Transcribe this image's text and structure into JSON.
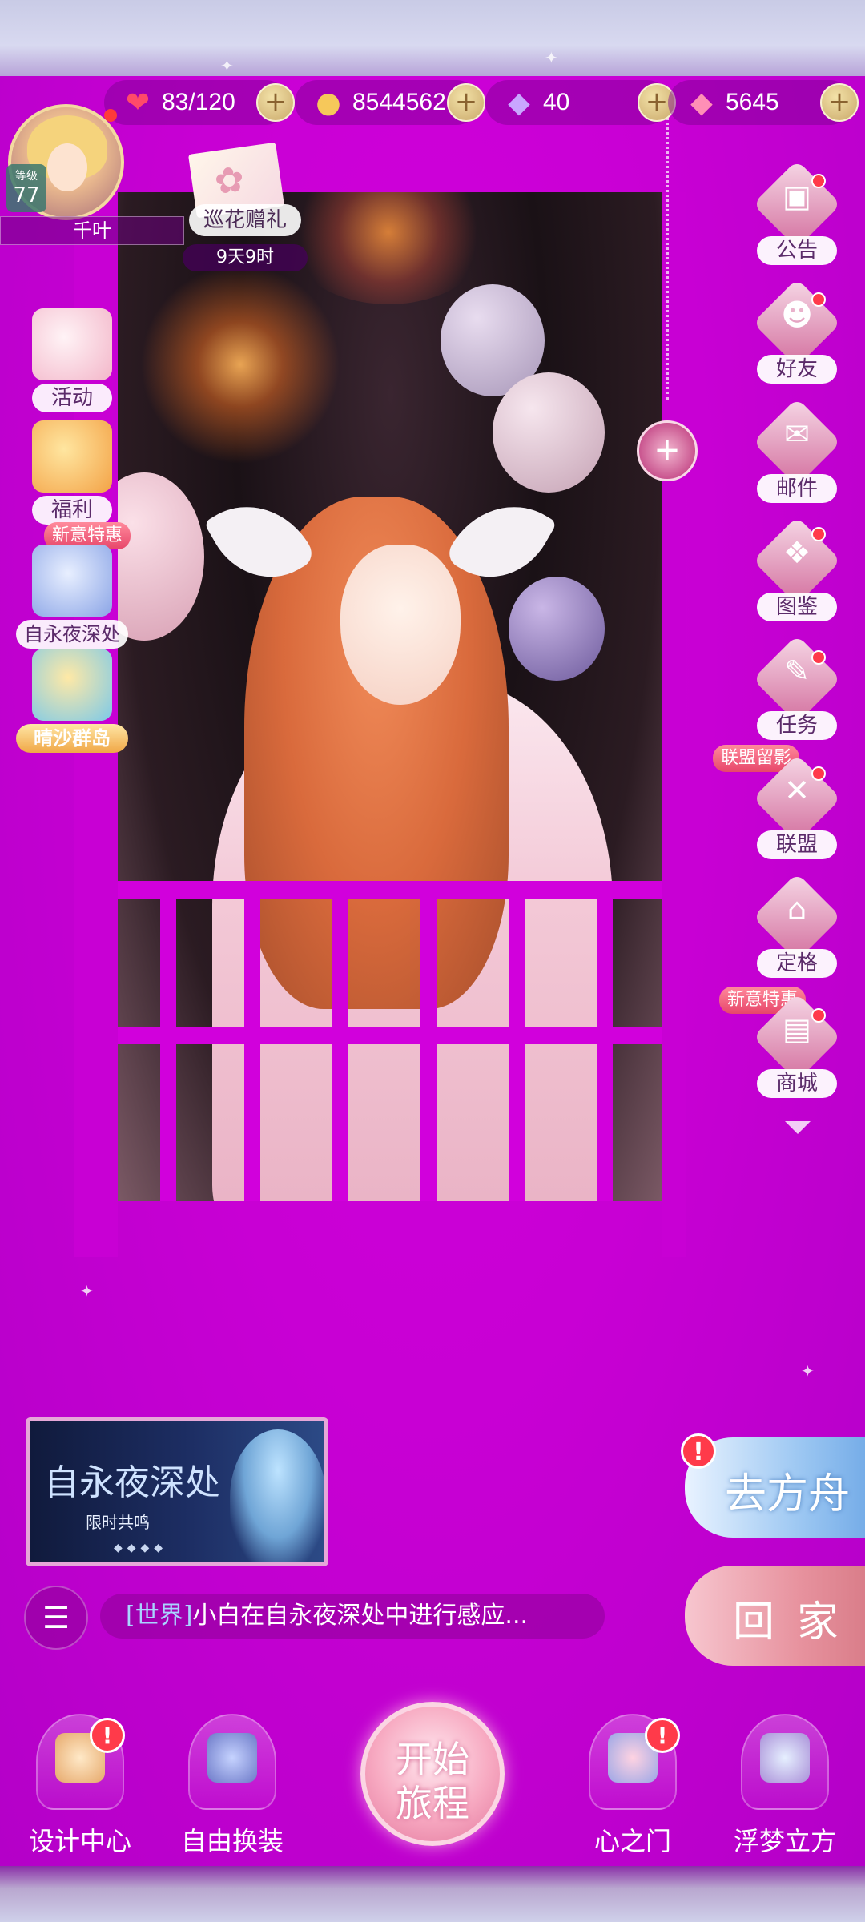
{
  "currencies": [
    {
      "icon": "heart-icon",
      "value": "83/120"
    },
    {
      "icon": "cat-coin-icon",
      "value": "8544562"
    },
    {
      "icon": "diamond-icon",
      "value": "40"
    },
    {
      "icon": "pink-diamond-icon",
      "value": "5645"
    }
  ],
  "player": {
    "level_label": "等级",
    "level": "77",
    "name": "千叶"
  },
  "event": {
    "label": "巡花赠礼",
    "timer": "9天9时"
  },
  "left_menu": {
    "activity": "活动",
    "welfare": "福利",
    "new_offer_badge": "新意特惠",
    "eternal_night": "自永夜深处",
    "sand_islands": "晴沙群岛"
  },
  "right_menu": {
    "announcement": "公告",
    "friends": "好友",
    "mail": "邮件",
    "gallery": "图鉴",
    "tasks": "任务",
    "alliance_badge": "联盟留影",
    "alliance": "联盟",
    "pose": "定格",
    "shop_badge": "新意特惠",
    "shop": "商城"
  },
  "promo": {
    "title": "自永夜深处",
    "subtitle": "限时共鸣"
  },
  "chat": {
    "channel": "[世界]",
    "message": "小白在自永夜深处中进行感应..."
  },
  "actions": {
    "ark": "去方舟",
    "home": "回家",
    "ark_alert": "!"
  },
  "bottom_nav": {
    "design_center": "设计中心",
    "free_dressing": "自由换装",
    "start_line1": "开始",
    "start_line2": "旅程",
    "heart_gate": "心之门",
    "dream_cube": "浮梦立方",
    "alert": "!"
  },
  "colors": {
    "background": "#cc00d6",
    "label_text": "#5b2b6a",
    "alert_red": "#ff3a4a",
    "chat_channel": "#a9d4ff"
  }
}
